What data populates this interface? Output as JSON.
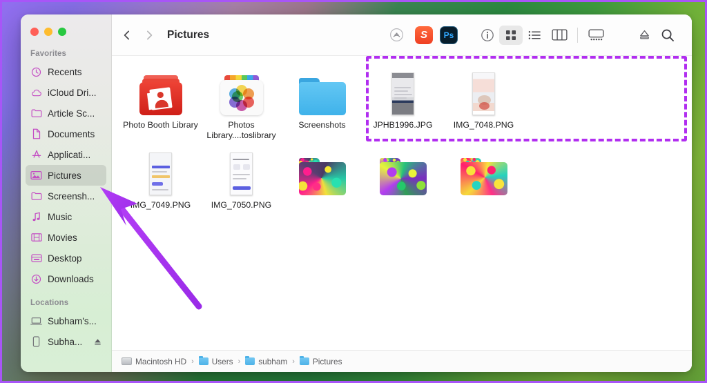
{
  "window": {
    "title": "Pictures",
    "traffic_lights": [
      "close",
      "minimize",
      "zoom"
    ]
  },
  "toolbar": {
    "back_label": "Back",
    "forward_label": "Forward",
    "airdrop_label": "AirDrop",
    "apps": [
      {
        "name": "sketch-app-icon",
        "glyph": "S"
      },
      {
        "name": "photoshop-app-icon",
        "glyph": "Ps"
      }
    ],
    "info_label": "i",
    "view_icon_label": "Icon View",
    "view_list_label": "List View",
    "view_column_label": "Column View",
    "view_gallery_label": "Gallery View",
    "eject_label": "Eject",
    "search_label": "Search"
  },
  "sidebar": {
    "sections": [
      {
        "header": "Favorites",
        "items": [
          {
            "label": "Recents",
            "icon": "clock-icon",
            "selected": false
          },
          {
            "label": "iCloud Dri...",
            "icon": "cloud-icon",
            "selected": false
          },
          {
            "label": "Article Sc...",
            "icon": "folder-icon",
            "selected": false
          },
          {
            "label": "Documents",
            "icon": "document-icon",
            "selected": false
          },
          {
            "label": "Applicati...",
            "icon": "appstore-icon",
            "selected": false
          },
          {
            "label": "Pictures",
            "icon": "pictures-icon",
            "selected": true
          },
          {
            "label": "Screensh...",
            "icon": "folder-icon",
            "selected": false
          },
          {
            "label": "Music",
            "icon": "music-note-icon",
            "selected": false
          },
          {
            "label": "Movies",
            "icon": "film-icon",
            "selected": false
          },
          {
            "label": "Desktop",
            "icon": "desktop-icon",
            "selected": false
          },
          {
            "label": "Downloads",
            "icon": "download-icon",
            "selected": false
          }
        ]
      },
      {
        "header": "Locations",
        "items": [
          {
            "label": "Subham's...",
            "icon": "laptop-icon",
            "selected": false
          },
          {
            "label": "Subha...",
            "icon": "iphone-icon",
            "selected": false,
            "eject": true
          }
        ]
      }
    ]
  },
  "files": [
    {
      "name": "Photo Booth Library",
      "kind": "photo-booth-library",
      "selected": false
    },
    {
      "name": "Photos Library....toslibrary",
      "kind": "photos-library",
      "selected": false
    },
    {
      "name": "Screenshots",
      "kind": "blue-folder",
      "selected": false
    },
    {
      "name": "JPHB1996.JPG",
      "kind": "image-thumbnail-dark",
      "selected": true
    },
    {
      "name": "IMG_7048.PNG",
      "kind": "image-thumbnail-light",
      "selected": true
    },
    {
      "name": "IMG_7049.PNG",
      "kind": "image-thumbnail-light",
      "selected": true
    },
    {
      "name": "IMG_7050.PNG",
      "kind": "image-thumbnail-light",
      "selected": true
    },
    {
      "name": "",
      "kind": "psychedelic-folder-1",
      "selected": false
    },
    {
      "name": "",
      "kind": "psychedelic-folder-2",
      "selected": false
    },
    {
      "name": "",
      "kind": "psychedelic-folder-3",
      "selected": false
    }
  ],
  "pathbar": {
    "crumbs": [
      {
        "label": "Macintosh HD",
        "icon": "harddisk-icon"
      },
      {
        "label": "Users",
        "icon": "folder-icon"
      },
      {
        "label": "subham",
        "icon": "folder-icon"
      },
      {
        "label": "Pictures",
        "icon": "folder-icon"
      }
    ],
    "separator": "›"
  },
  "annotations": {
    "selection_box_color": "#b12ef0",
    "arrow_color": "#a42ef0",
    "arrow_target": "Pictures"
  },
  "colors": {
    "accent_purple": "#a855f7",
    "folder_blue": "#4db2e8",
    "sidebar_icon": "#c44ec4"
  }
}
